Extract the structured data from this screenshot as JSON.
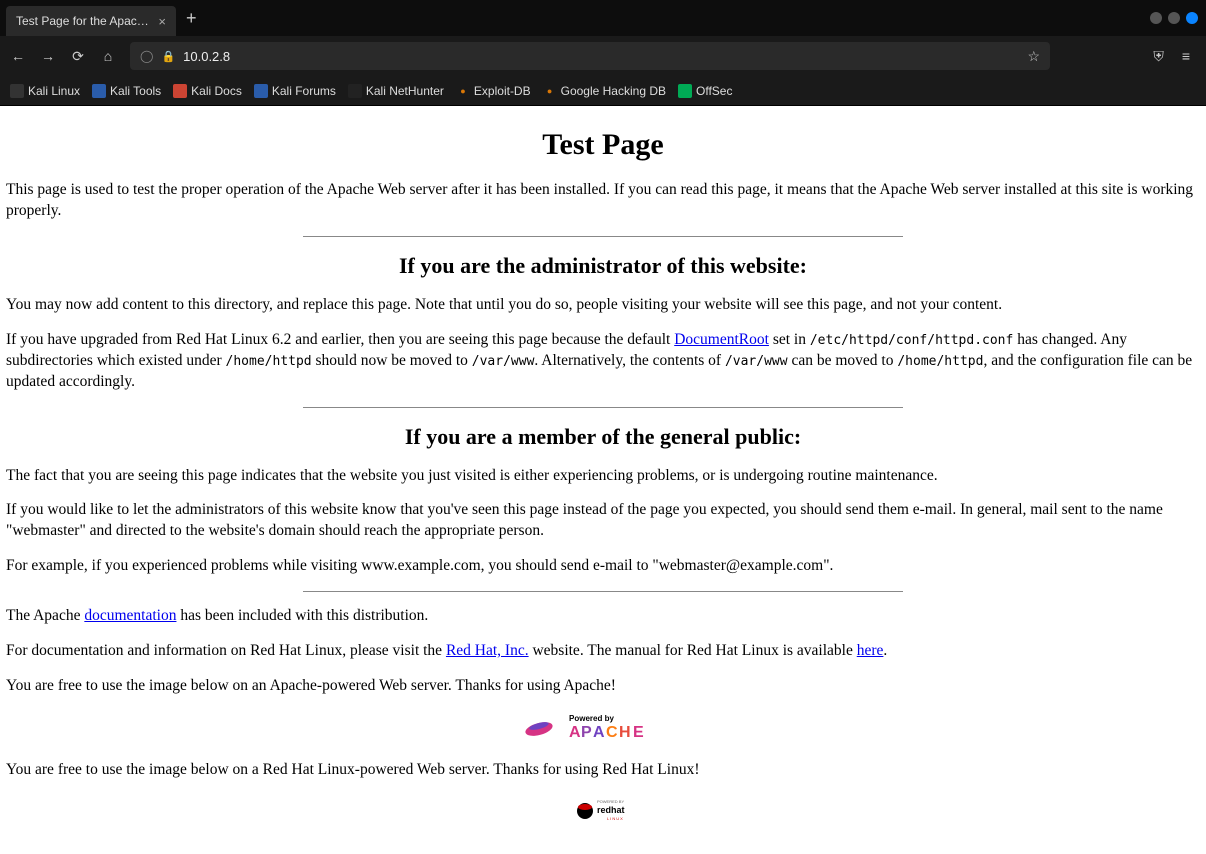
{
  "tab": {
    "title": "Test Page for the Apache We"
  },
  "url": "10.0.2.8",
  "bookmarks": [
    {
      "label": "Kali Linux",
      "iconClass": "bm-kali"
    },
    {
      "label": "Kali Tools",
      "iconClass": "bm-tools"
    },
    {
      "label": "Kali Docs",
      "iconClass": "bm-docs"
    },
    {
      "label": "Kali Forums",
      "iconClass": "bm-forums"
    },
    {
      "label": "Kali NetHunter",
      "iconClass": "bm-nethunter"
    },
    {
      "label": "Exploit-DB",
      "iconClass": "bm-exploit"
    },
    {
      "label": "Google Hacking DB",
      "iconClass": "bm-ghdb"
    },
    {
      "label": "OffSec",
      "iconClass": "bm-offsec"
    }
  ],
  "page": {
    "h1": "Test Page",
    "intro": "This page is used to test the proper operation of the Apache Web server after it has been installed. If you can read this page, it means that the Apache Web server installed at this site is working properly.",
    "admin_heading": "If you are the administrator of this website:",
    "admin_p1": "You may now add content to this directory, and replace this page. Note that until you do so, people visiting your website will see this page, and not your content.",
    "admin_p2_a": "If you have upgraded from Red Hat Linux 6.2 and earlier, then you are seeing this page because the default ",
    "admin_p2_link": "DocumentRoot",
    "admin_p2_b": " set in ",
    "admin_p2_tt1": "/etc/httpd/conf/httpd.conf",
    "admin_p2_c": " has changed. Any subdirectories which existed under ",
    "admin_p2_tt2": "/home/httpd",
    "admin_p2_d": " should now be moved to ",
    "admin_p2_tt3": "/var/www",
    "admin_p2_e": ". Alternatively, the contents of ",
    "admin_p2_tt4": "/var/www",
    "admin_p2_f": " can be moved to ",
    "admin_p2_tt5": "/home/httpd",
    "admin_p2_g": ", and the configuration file can be updated accordingly.",
    "public_heading": "If you are a member of the general public:",
    "public_p1": "The fact that you are seeing this page indicates that the website you just visited is either experiencing problems, or is undergoing routine maintenance.",
    "public_p2": "If you would like to let the administrators of this website know that you've seen this page instead of the page you expected, you should send them e-mail. In general, mail sent to the name \"webmaster\" and directed to the website's domain should reach the appropriate person.",
    "public_p3": "For example, if you experienced problems while visiting www.example.com, you should send e-mail to \"webmaster@example.com\".",
    "doc_p_a": "The Apache ",
    "doc_link": "documentation",
    "doc_p_b": " has been included with this distribution.",
    "rh_p_a": "For documentation and information on Red Hat Linux, please visit the ",
    "rh_link1": "Red Hat, Inc.",
    "rh_p_b": " website. The manual for Red Hat Linux is available ",
    "rh_link2": "here",
    "rh_p_c": ".",
    "apache_img_p": "You are free to use the image below on an Apache-powered Web server. Thanks for using Apache!",
    "redhat_img_p": "You are free to use the image below on a Red Hat Linux-powered Web server. Thanks for using Red Hat Linux!"
  }
}
